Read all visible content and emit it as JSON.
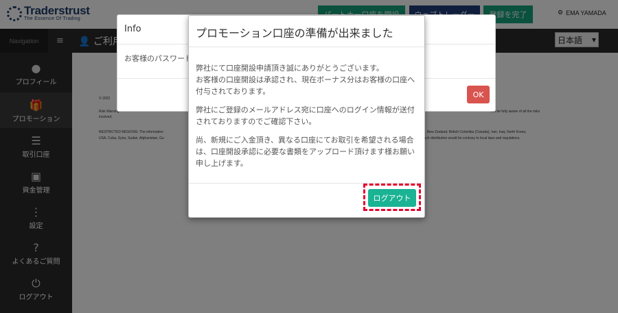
{
  "header": {
    "logo": {
      "name": "Traderstrust",
      "tagline": "The Essence Of Trading"
    },
    "partner_button": "パートナー口座を開設",
    "webtrader_button": "ウェブトレーダー",
    "register_button": "登録を完了",
    "user_name": "EMA YAMADA"
  },
  "navbar": {
    "label": "Navigation",
    "title": "ご利用",
    "language": "日本語"
  },
  "sidebar": {
    "items": [
      {
        "label": "プロフィール",
        "icon": "user-icon"
      },
      {
        "label": "プロモーション",
        "icon": "gift-icon"
      },
      {
        "label": "取引口座",
        "icon": "accounts-icon"
      },
      {
        "label": "資金管理",
        "icon": "money-icon"
      },
      {
        "label": "設定",
        "icon": "more-icon"
      },
      {
        "label": "よくあるご質問",
        "icon": "question-icon"
      },
      {
        "label": "ログアウト",
        "icon": "power-icon"
      }
    ]
  },
  "content": {
    "copyright": "© 2022",
    "risk_label": "Risk Warning",
    "risk_tail": "not be fully aware of all the risks",
    "risk_end": "involved.",
    "restricted_label": "RESTRICTED REGIONS: The information",
    "restricted_tail": "ia, New Zealand, British Columbia (Canada), Iran, Iraq, North Korea,",
    "restricted_line2": "USA, Cuba, Syria, Sudan, Afghanistan, Gu",
    "restricted_tail2": "such distribution would be contrary to local laws and regulations."
  },
  "info_modal": {
    "title": "Info",
    "body": "お客様のパスワード",
    "ok_label": "OK"
  },
  "promo_modal": {
    "title": "プロモーション口座の準備が出来ました",
    "close_label": "×",
    "paragraphs": [
      "弊社にて口座開設申請頂き誠にありがとうございます。\nお客様の口座開設は承認され、現在ボーナス分はお客様の口座へ付与されております。",
      "弊社にご登録のメールアドレス宛に口座へのログイン情報が送付されておりますのでご確認下さい。",
      "尚、新規にご入金頂き、異なる口座にてお取引を希望される場合は、口座開設承認に必要な書類をアップロード頂けます様お願い申し上げます。"
    ],
    "logout_label": "ログアウト"
  },
  "colors": {
    "green": "#1ab394",
    "navy": "#1f3c7b",
    "danger": "#d9534f",
    "highlight": "#e4002b"
  }
}
